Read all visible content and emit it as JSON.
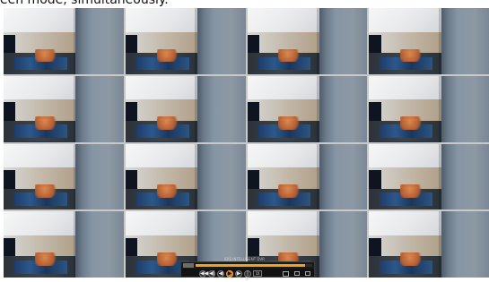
{
  "caption": {
    "text": "een mode, simultaneously."
  },
  "grid": {
    "selected_tile_index": 2,
    "tiles": [
      {
        "label": ""
      },
      {
        "label": ""
      },
      {
        "label": ""
      },
      {
        "label": ""
      },
      {
        "label": ""
      },
      {
        "label": ""
      },
      {
        "label": ""
      },
      {
        "label": ""
      },
      {
        "label": ""
      },
      {
        "label": ""
      },
      {
        "label": ""
      },
      {
        "label": ""
      },
      {
        "label": ""
      },
      {
        "label": ""
      },
      {
        "label": ""
      },
      {
        "label": ""
      }
    ]
  },
  "playback": {
    "progress": 0.94,
    "speed_label": "1X",
    "controls": [
      {
        "name": "rewind",
        "glyph": "◀◀"
      },
      {
        "name": "step-back",
        "glyph": "◀|"
      },
      {
        "name": "prev",
        "glyph": "◀"
      },
      {
        "name": "play",
        "glyph": "▶"
      },
      {
        "name": "next",
        "glyph": "▶"
      },
      {
        "name": "step-forward",
        "glyph": "|▶"
      }
    ]
  },
  "overlay": {
    "watermark": "IDIS INTELLIGENT DVR"
  },
  "colors": {
    "accent_orange": "#d77b10",
    "selected_outline": "#6ee06e",
    "label_yellow": "#ffea3a"
  }
}
